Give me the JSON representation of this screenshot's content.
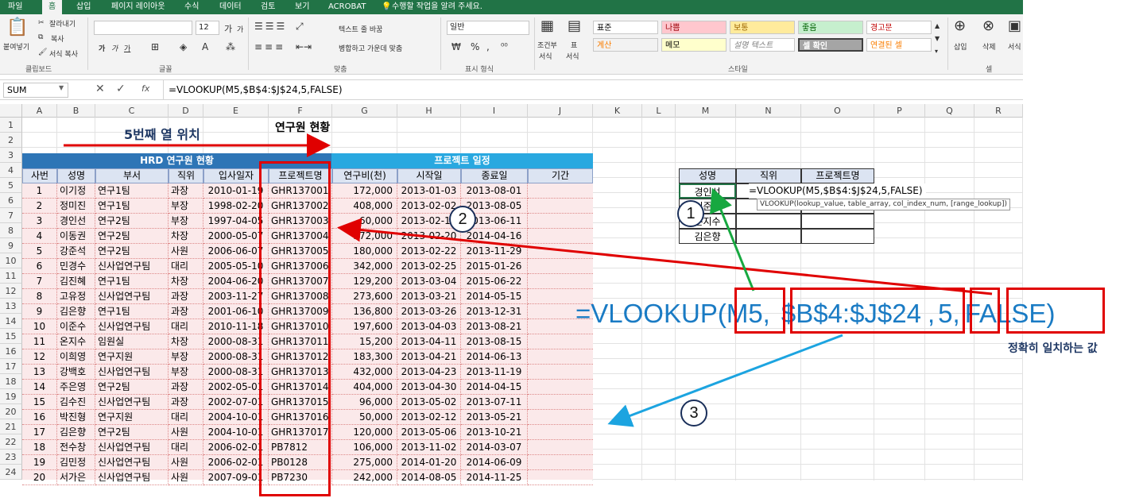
{
  "ribbon": {
    "tabs": [
      "파일",
      "홈",
      "삽입",
      "페이지 레이아웃",
      "수식",
      "데이터",
      "검토",
      "보기",
      "ACROBAT"
    ],
    "tellme": "수행할 작업을 알려 주세요.",
    "clipboard": {
      "paste": "붙여넣기",
      "cut": "잘라내기",
      "copy": "복사",
      "painter": "서식 복사",
      "label": "클립보드"
    },
    "font": {
      "size": "12",
      "label": "글꼴",
      "inc": "가",
      "dec": "가",
      "bold": "가",
      "italic": "가",
      "underline": "가"
    },
    "align": {
      "wrap": "텍스트 줄 바꿈",
      "merge": "병합하고 가운데 맞춤",
      "label": "맞춤"
    },
    "number": {
      "format": "일반",
      "pct": "%",
      "comma": ",",
      "label": "표시 형식"
    },
    "styles": {
      "cond_fmt": "조건부",
      "cond_fmt2": "서식",
      "table_fmt": "표",
      "table_fmt2": "서식",
      "label": "스타일",
      "cells": [
        "표준",
        "나쁨",
        "보통",
        "좋음",
        "경고문",
        "계산",
        "메모",
        "설명 텍스트",
        "셀 확인",
        "연결된 셀"
      ]
    },
    "cells": {
      "insert": "삽입",
      "delete": "삭제",
      "format": "서식",
      "label": "셀"
    }
  },
  "formula_bar": {
    "name_box": "SUM",
    "fx": "fx",
    "formula": "=VLOOKUP(M5,$B$4:$J$24,5,FALSE)"
  },
  "columns": [
    "A",
    "B",
    "C",
    "D",
    "E",
    "F",
    "G",
    "H",
    "I",
    "J",
    "K",
    "L",
    "M",
    "N",
    "O",
    "P",
    "Q",
    "R"
  ],
  "rows": [
    "1",
    "2",
    "3",
    "4",
    "5",
    "6",
    "7",
    "8",
    "9",
    "10",
    "11",
    "12",
    "13",
    "14",
    "15",
    "16",
    "17",
    "18",
    "19",
    "20",
    "21",
    "22",
    "23",
    "24"
  ],
  "sheet": {
    "title": "연구원 현황",
    "group1": "HRD 연구원 현황",
    "group2": "프로젝트 일정",
    "headers": [
      "사번",
      "성명",
      "부서",
      "직위",
      "입사일자",
      "프로젝트명",
      "연구비(천)",
      "시작일",
      "종료일",
      "기간"
    ],
    "data": [
      [
        "1",
        "이기정",
        "연구1팀",
        "과장",
        "2010-01-19",
        "GHR137001",
        "172,000",
        "2013-01-03",
        "2013-08-01"
      ],
      [
        "2",
        "정미진",
        "연구1팀",
        "부장",
        "1998-02-20",
        "GHR137002",
        "408,000",
        "2013-02-02",
        "2013-08-05"
      ],
      [
        "3",
        "경인선",
        "연구2팀",
        "부장",
        "1997-04-05",
        "GHR137003",
        "60,000",
        "2013-02-13",
        "2013-06-11"
      ],
      [
        "4",
        "이동권",
        "연구2팀",
        "차장",
        "2000-05-07",
        "GHR137004",
        "372,000",
        "2013-02-20",
        "2014-04-16"
      ],
      [
        "5",
        "강준석",
        "연구2팀",
        "사원",
        "2006-06-07",
        "GHR137005",
        "180,000",
        "2013-02-22",
        "2013-11-29"
      ],
      [
        "6",
        "민경수",
        "신사업연구팀",
        "대리",
        "2005-05-10",
        "GHR137006",
        "342,000",
        "2013-02-25",
        "2015-01-26"
      ],
      [
        "7",
        "김진혜",
        "연구1팀",
        "차장",
        "2004-06-20",
        "GHR137007",
        "129,200",
        "2013-03-04",
        "2015-06-22"
      ],
      [
        "8",
        "고유정",
        "신사업연구팀",
        "과장",
        "2003-11-27",
        "GHR137008",
        "273,600",
        "2013-03-21",
        "2014-05-15"
      ],
      [
        "9",
        "김은향",
        "연구1팀",
        "과장",
        "2001-06-10",
        "GHR137009",
        "136,800",
        "2013-03-26",
        "2013-12-31"
      ],
      [
        "10",
        "이준수",
        "신사업연구팀",
        "대리",
        "2010-11-18",
        "GHR137010",
        "197,600",
        "2013-04-03",
        "2013-08-21"
      ],
      [
        "11",
        "온지수",
        "임원실",
        "차장",
        "2000-08-31",
        "GHR137011",
        "15,200",
        "2013-04-11",
        "2013-08-15"
      ],
      [
        "12",
        "이희영",
        "연구지원",
        "부장",
        "2000-08-31",
        "GHR137012",
        "183,300",
        "2013-04-21",
        "2014-06-13"
      ],
      [
        "13",
        "강백호",
        "신사업연구팀",
        "부장",
        "2000-08-31",
        "GHR137013",
        "432,000",
        "2013-04-23",
        "2013-11-19"
      ],
      [
        "14",
        "주은영",
        "연구2팀",
        "과장",
        "2002-05-01",
        "GHR137014",
        "404,000",
        "2013-04-30",
        "2014-04-15"
      ],
      [
        "15",
        "김수진",
        "신사업연구팀",
        "과장",
        "2002-07-01",
        "GHR137015",
        "96,000",
        "2013-05-02",
        "2013-07-11"
      ],
      [
        "16",
        "박진형",
        "연구지원",
        "대리",
        "2004-10-01",
        "GHR137016",
        "50,000",
        "2013-02-12",
        "2013-05-21"
      ],
      [
        "17",
        "김은향",
        "연구2팀",
        "사원",
        "2004-10-01",
        "GHR137017",
        "120,000",
        "2013-05-06",
        "2013-10-21"
      ],
      [
        "18",
        "전수창",
        "신사업연구팀",
        "대리",
        "2006-02-01",
        "PB7812",
        "106,000",
        "2013-11-02",
        "2014-03-07"
      ],
      [
        "19",
        "김민정",
        "신사업연구팀",
        "사원",
        "2006-02-01",
        "PB0128",
        "275,000",
        "2014-01-20",
        "2014-06-09"
      ],
      [
        "20",
        "서가은",
        "신사업연구팀",
        "사원",
        "2007-09-01",
        "PB7230",
        "242,000",
        "2014-08-05",
        "2014-11-25"
      ]
    ]
  },
  "lookup": {
    "headers": [
      "성명",
      "직위",
      "프로젝트명"
    ],
    "names": [
      "경인선",
      "이준수",
      "온지수",
      "김은향"
    ],
    "cell_edit": "=VLOOKUP(M5,$B$4:$J$24,5,FALSE)",
    "tooltip": "VLOOKUP(lookup_value, table_array, col_index_num, [range_lookup])"
  },
  "annotations": {
    "col5": "5번째 열 위치",
    "formula_prefix": "=VLOOKUP(",
    "arg1": "M5",
    "arg2": "$B$4:$J$24",
    "arg3": "5",
    "arg4": "FALSE",
    "close": ")",
    "sep": ",",
    "exact": "정확히 일치하는 값",
    "c1": "1",
    "c2": "2",
    "c3": "3"
  }
}
